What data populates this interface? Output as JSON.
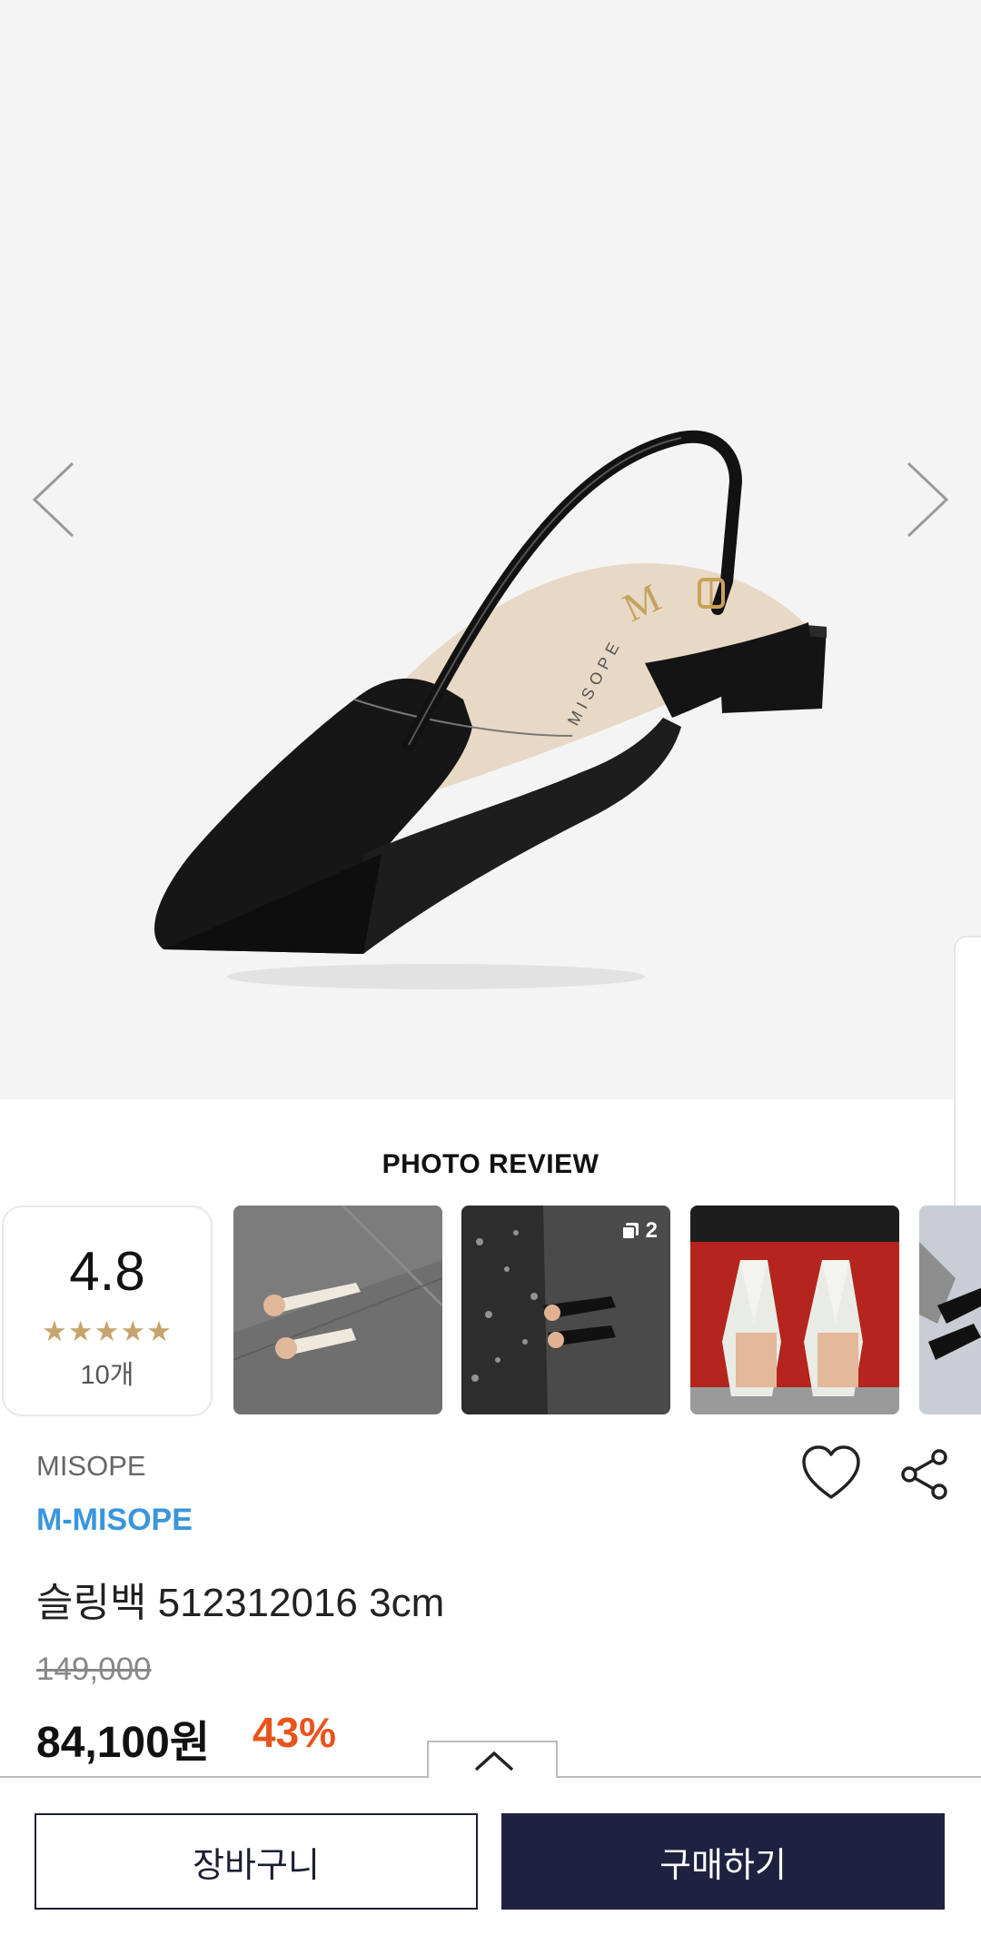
{
  "hero": {
    "brand_mark": "M",
    "brand_text": "MISOPE"
  },
  "photo_review": {
    "title": "PHOTO REVIEW",
    "rating": "4.8",
    "stars": "★★★★★",
    "count": "10개",
    "thumbnails": [
      {
        "badge": ""
      },
      {
        "badge": "2"
      },
      {
        "badge": ""
      },
      {
        "badge": ""
      }
    ]
  },
  "product": {
    "brand": "MISOPE",
    "sub_brand": "M-MISOPE",
    "name": "슬링백 512312016 3cm",
    "original_price": "149,000",
    "sale_price": "84,100원",
    "discount": "43%"
  },
  "actions": {
    "cart_label": "장바구니",
    "buy_label": "구매하기"
  },
  "colors": {
    "accent_blue": "#3a96db",
    "discount_orange": "#e8541b",
    "buy_button": "#1e2140",
    "star_gold": "#c5a46d"
  }
}
